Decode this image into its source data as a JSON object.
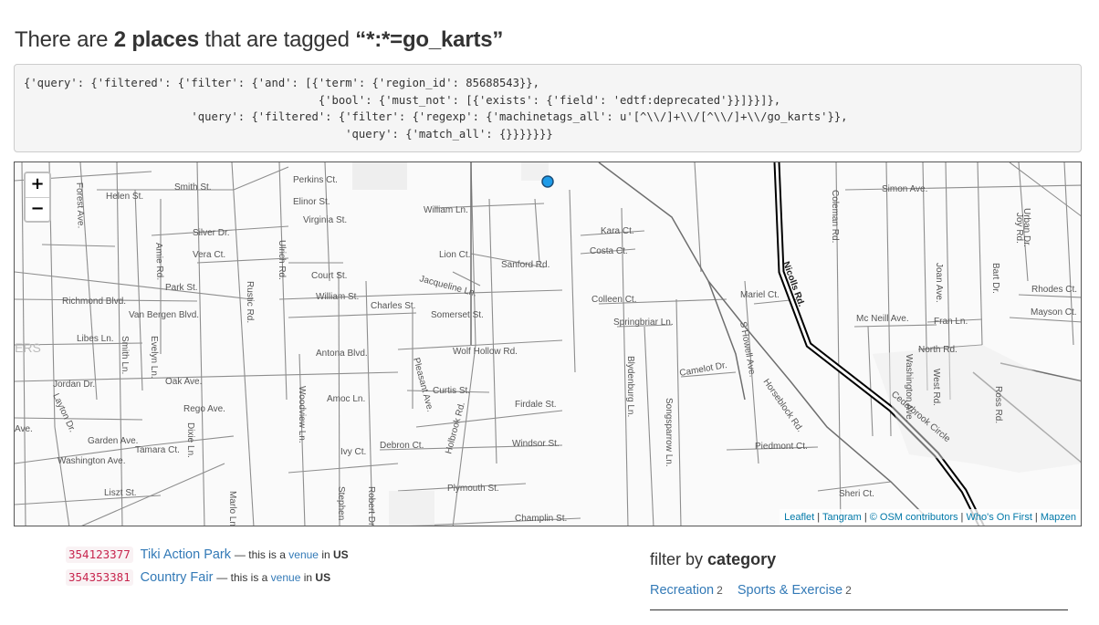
{
  "heading": {
    "prefix": "There are",
    "count_label": "2 places",
    "middle": "that are tagged",
    "tag": "“*:*=go_karts”"
  },
  "query": {
    "text": "{'query': {'filtered': {'filter': {'and': [{'term': {'region_id': 85688543}},\n                                            {'bool': {'must_not': [{'exists': {'field': 'edtf:deprecated'}}]}}]},\n                         'query': {'filtered': {'filter': {'regexp': {'machinetags_all': u'[^\\\\/]+\\\\/[^\\\\/]+\\\\/go_karts'}},\n                                                'query': {'match_all': {}}}}}}}"
  },
  "map": {
    "zoom_in_label": "+",
    "zoom_out_label": "−",
    "attribution": {
      "leaflet": "Leaflet",
      "tangram": "Tangram",
      "osm": "© OSM contributors",
      "wof": "Who's On First",
      "mapzen": "Mapzen",
      "separator": " | "
    },
    "marker_color": "#1e9be8",
    "street_labels": [
      "Forest Ave.",
      "Helen St.",
      "Smith St.",
      "Silver Dr.",
      "Vera Ct.",
      "Amie Rd.",
      "Park St.",
      "Richmond Blvd.",
      "Van Bergen Blvd.",
      "Libes Ln.",
      "Smith Ln.",
      "Evelyn Ln.",
      "Jordan Dr.",
      "Oak Ave.",
      "Rego Ave.",
      "Layton Dr.",
      "Garden Ave.",
      "Tamara Ct.",
      "Washington Ave.",
      "Liszt St.",
      "Dixie Ln.",
      "Rustic Rd.",
      "Ulrich Rd.",
      "Perkins Ct.",
      "Elinor St.",
      "Virginia St.",
      "Court St.",
      "William St.",
      "Charles St.",
      "Antona Blvd.",
      "Amoc Ln.",
      "Woodview Ln.",
      "Ivy Ct.",
      "Debron Ct.",
      "Stephen",
      "Robert Dr.",
      "Marlo Ln.",
      "William Ln.",
      "Lion Ct.",
      "Sanford Rd.",
      "Jacqueline Ln.",
      "Somerset St.",
      "Wolf Hollow Rd.",
      "Pleasant Ave.",
      "Curtis St.",
      "Holbrook Rd.",
      "Firdale St.",
      "Windsor St.",
      "Plymouth St.",
      "Champlin St.",
      "Kara Ct.",
      "Costa Ct.",
      "Colleen Ct.",
      "Springbriar Ln.",
      "Blydenburg Ln.",
      "Songsparrow Ln.",
      "Camelot Dr.",
      "Horseblock Rd.",
      "Mariel Ct.",
      "S Howell Ave.",
      "Nicolls Rd.",
      "Piedmont Ct.",
      "Sheri Ct.",
      "Coleman Rd.",
      "Simon Ave.",
      "Mc Neill Ave.",
      "Fran Ln.",
      "Joan Ave.",
      "North Rd.",
      "Washington Ave.",
      "West Rd.",
      "Bart Dr.",
      "Joy Rd.",
      "Urban Dr.",
      "Rhodes Ct.",
      "Mayson Ct.",
      "Ross Rd.",
      "Cedarbrook Circle",
      "ERS",
      "Ave."
    ]
  },
  "places": [
    {
      "id": "354123377",
      "name": "Tiki Action Park",
      "sep": "—",
      "desc": "this is a",
      "type": "venue",
      "in": "in",
      "country": "US"
    },
    {
      "id": "354353381",
      "name": "Country Fair",
      "sep": "—",
      "desc": "this is a",
      "type": "venue",
      "in": "in",
      "country": "US"
    }
  ],
  "filter": {
    "title_prefix": "filter by",
    "title_bold": "category",
    "facets": [
      {
        "label": "Recreation",
        "count": "2"
      },
      {
        "label": "Sports & Exercise",
        "count": "2"
      }
    ]
  }
}
